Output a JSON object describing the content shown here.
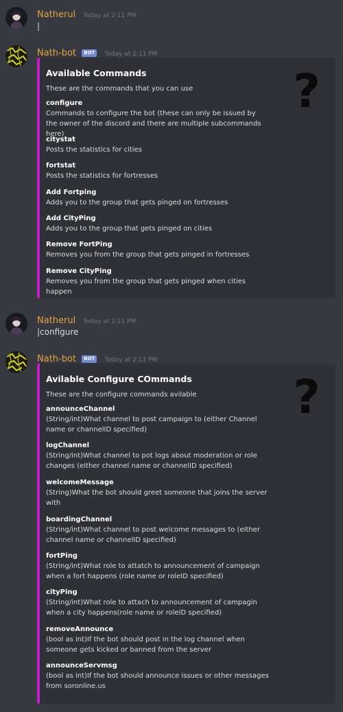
{
  "messages": [
    {
      "author": "Natherul",
      "timestamp": "Today at 2:11 PM",
      "content": "|"
    },
    {
      "author": "Nath-bot",
      "badge": "BOT",
      "timestamp": "Today at 2:11 PM",
      "embed": {
        "title": "Available Commands",
        "description": "These are the commands that you can use",
        "thumbnail": "?",
        "fields": [
          {
            "name": "configure",
            "value": "Commands to configure the bot (these can only be issued by the owner of the discord and there are multiple subcommands here)"
          },
          {
            "name": "citystat",
            "value": "Posts the statistics for cities"
          },
          {
            "name": "fortstat",
            "value": "Posts the statistics for fortresses"
          },
          {
            "name": "Add Fortping",
            "value": "Adds you to the group that gets pinged on fortresses"
          },
          {
            "name": "Add CityPing",
            "value": "Adds you to the group that gets pinged on cities"
          },
          {
            "name": "Remove FortPing",
            "value": "Removes you from the group that gets pinged in fortresses"
          },
          {
            "name": "Remove CityPing",
            "value": "Removes you from the group that gets pinged when cities happen"
          }
        ]
      }
    },
    {
      "author": "Natherul",
      "timestamp": "Today at 2:11 PM",
      "content": "|configure"
    },
    {
      "author": "Nath-bot",
      "badge": "BOT",
      "timestamp": "Today at 2:11 PM",
      "embed": {
        "title": "Avilable Configure COmmands",
        "description": "These are the configure commands avilable",
        "thumbnail": "?",
        "fields": [
          {
            "name": "announceChannel",
            "value": "(String/int)What channel to post campaign to (either Channel name or channelID specified)"
          },
          {
            "name": "logChannel",
            "value": "(String/int)What channel to pot logs about moderation or role changes (either channel name or channelID specified)"
          },
          {
            "name": "welcomeMessage",
            "value": "(String)What the bot should greet someone that joins the server with"
          },
          {
            "name": "boardingChannel",
            "value": "(String/int)What channel to post welcome messages to (either channel name or channelID specified)"
          },
          {
            "name": "fortPing",
            "value": "(String/int)What role to attatch to announcement of campaign when a fort happens (role name or roleID specified)"
          },
          {
            "name": "cityPing",
            "value": "(String/int)What role to attach to announcement of campagin when a city happens(role name or roleID specified)"
          },
          {
            "name": "removeAnnounce",
            "value": "(bool as int)If the bot should post in the log channel when someone gets kicked or banned from the server"
          },
          {
            "name": "announceServmsg",
            "value": "(bool as int)If the bot should announce issues or other messages from soronline.us"
          }
        ]
      }
    }
  ],
  "colors": {
    "background": "#36393f",
    "embed_background": "#2f3136",
    "embed_accent": "#c61ec6",
    "username": "#e6a23a",
    "bot_badge": "#7289da"
  }
}
